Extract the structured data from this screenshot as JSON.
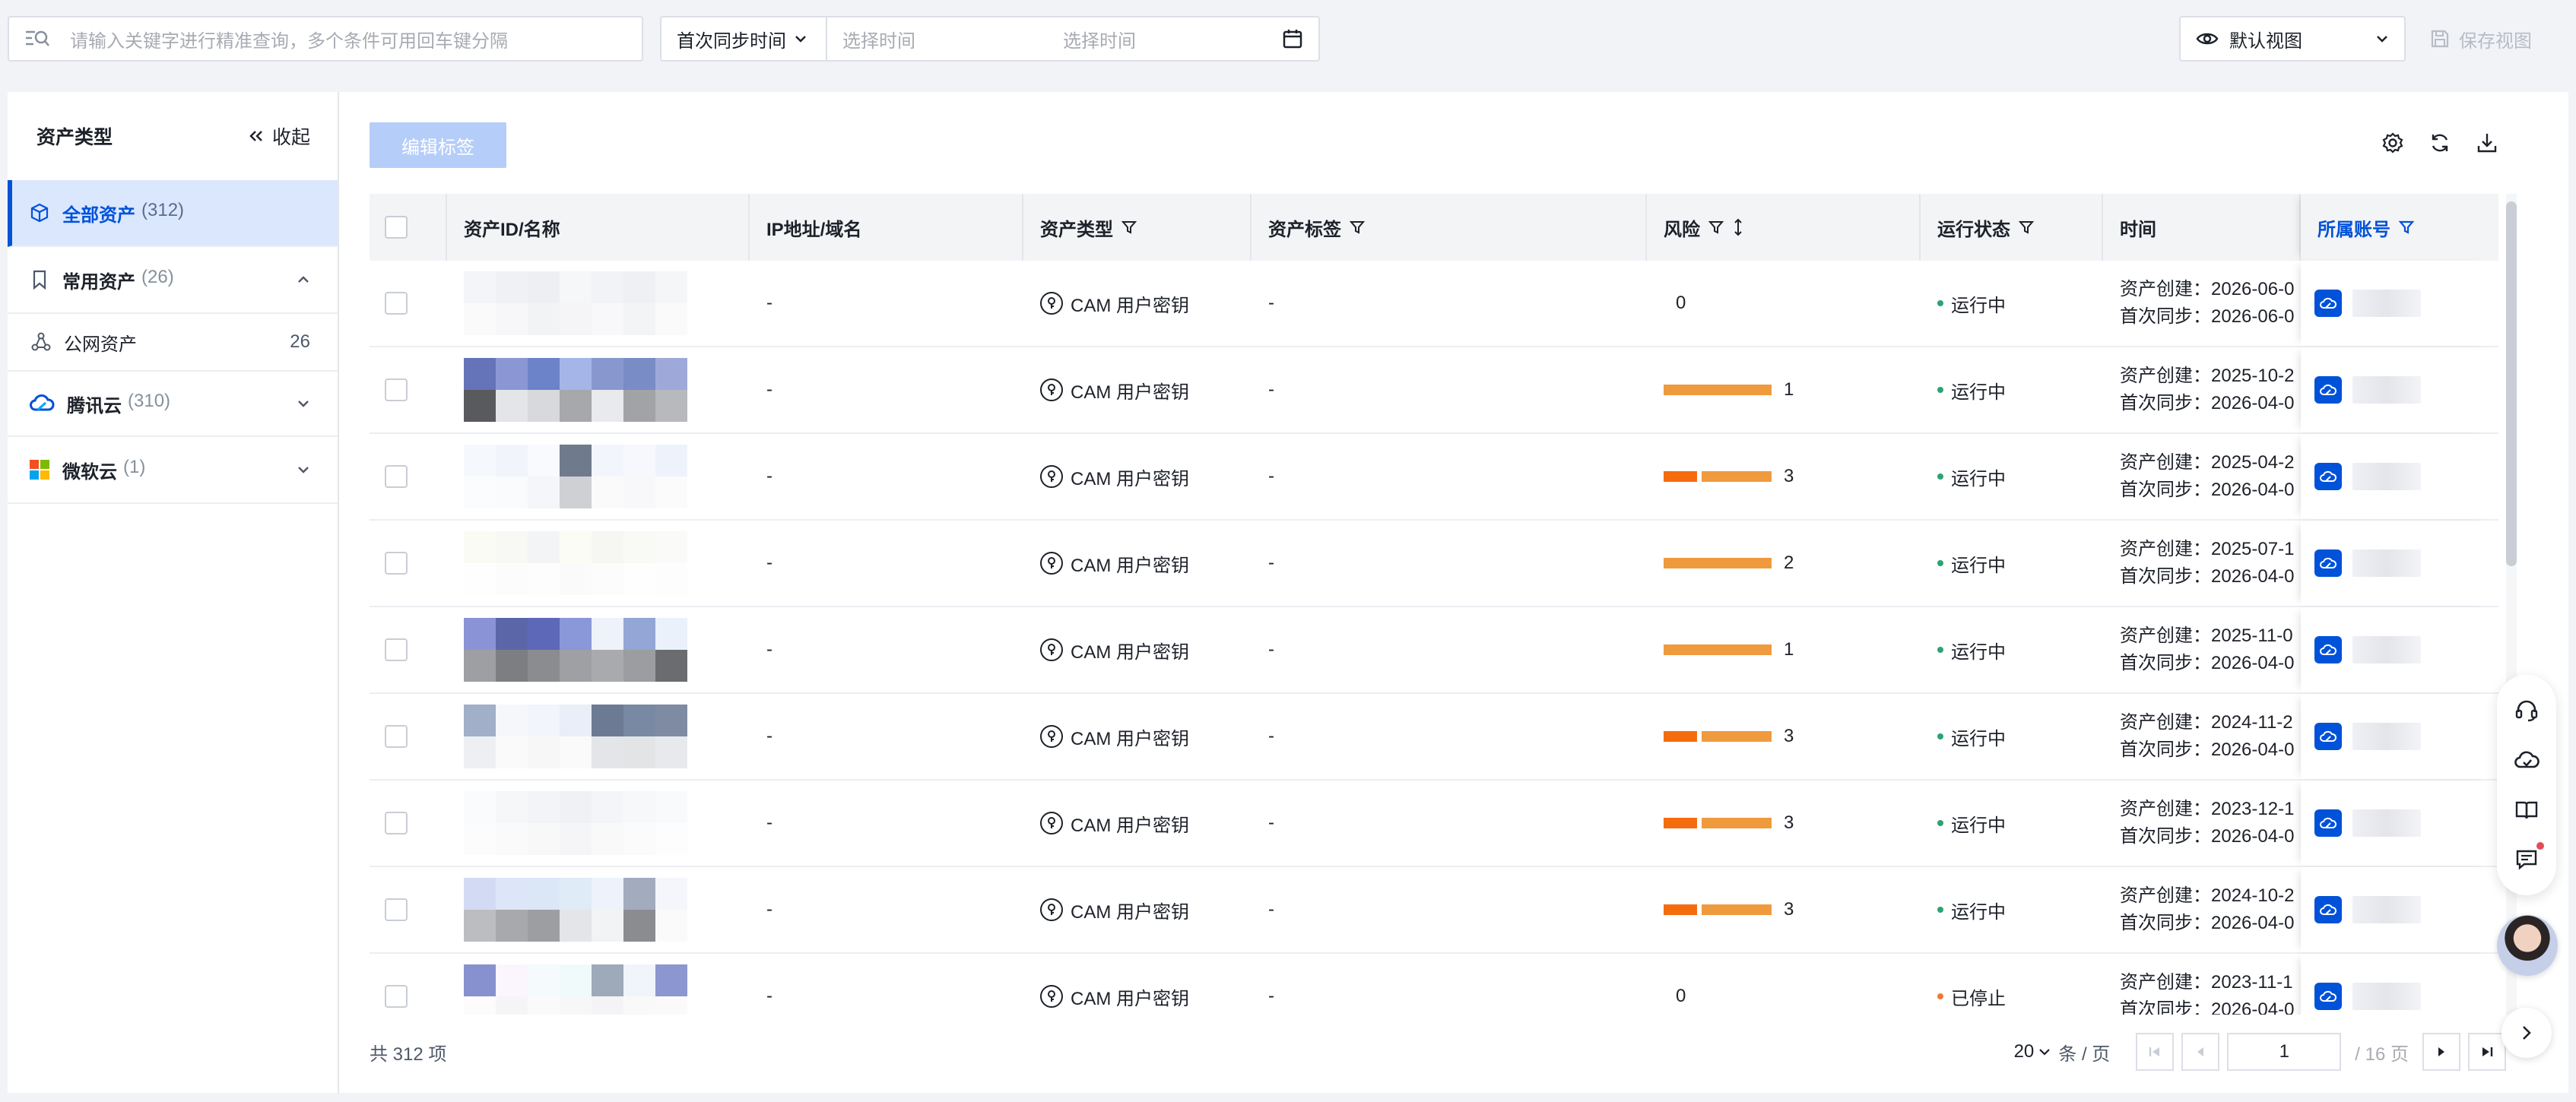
{
  "topbar": {
    "search_placeholder": "请输入关键字进行精准查询，多个条件可用回车键分隔",
    "time_filter_label": "首次同步时间",
    "date_start_placeholder": "选择时间",
    "date_end_placeholder": "选择时间",
    "view_label": "默认视图",
    "save_view_label": "保存视图"
  },
  "sidebar": {
    "title": "资产类型",
    "collapse_label": "收起",
    "items": [
      {
        "label": "全部资产",
        "count": "(312)"
      },
      {
        "label": "常用资产",
        "count": "(26)"
      },
      {
        "label": "公网资产",
        "count": "26"
      },
      {
        "label": "腾讯云",
        "count": "(310)"
      },
      {
        "label": "微软云",
        "count": "(1)"
      }
    ]
  },
  "toolbar": {
    "edit_tag_label": "编辑标签",
    "icons": [
      "settings-icon",
      "refresh-icon",
      "download-icon"
    ]
  },
  "table": {
    "columns": [
      "资产ID/名称",
      "IP地址/域名",
      "资产类型",
      "资产标签",
      "风险",
      "运行状态",
      "时间",
      "所属账号"
    ],
    "rows": [
      {
        "ip": "-",
        "type": "CAM 用户密钥",
        "tag": "-",
        "risk": "0",
        "risk_level": 0,
        "status": "运行中",
        "status_color": "#2ba471",
        "created": "资产创建：2026-06-0",
        "synced": "首次同步：2026-06-0"
      },
      {
        "ip": "-",
        "type": "CAM 用户密钥",
        "tag": "-",
        "risk": "1",
        "risk_level": 1,
        "status": "运行中",
        "status_color": "#2ba471",
        "created": "资产创建：2025-10-2",
        "synced": "首次同步：2026-04-0"
      },
      {
        "ip": "-",
        "type": "CAM 用户密钥",
        "tag": "-",
        "risk": "3",
        "risk_level": 3,
        "status": "运行中",
        "status_color": "#2ba471",
        "created": "资产创建：2025-04-2",
        "synced": "首次同步：2026-04-0"
      },
      {
        "ip": "-",
        "type": "CAM 用户密钥",
        "tag": "-",
        "risk": "2",
        "risk_level": 2,
        "status": "运行中",
        "status_color": "#2ba471",
        "created": "资产创建：2025-07-1",
        "synced": "首次同步：2026-04-0"
      },
      {
        "ip": "-",
        "type": "CAM 用户密钥",
        "tag": "-",
        "risk": "1",
        "risk_level": 1,
        "status": "运行中",
        "status_color": "#2ba471",
        "created": "资产创建：2025-11-0",
        "synced": "首次同步：2026-04-0"
      },
      {
        "ip": "-",
        "type": "CAM 用户密钥",
        "tag": "-",
        "risk": "3",
        "risk_level": 3,
        "status": "运行中",
        "status_color": "#2ba471",
        "created": "资产创建：2024-11-2",
        "synced": "首次同步：2026-04-0"
      },
      {
        "ip": "-",
        "type": "CAM 用户密钥",
        "tag": "-",
        "risk": "3",
        "risk_level": 3,
        "status": "运行中",
        "status_color": "#2ba471",
        "created": "资产创建：2023-12-1",
        "synced": "首次同步：2026-04-0"
      },
      {
        "ip": "-",
        "type": "CAM 用户密钥",
        "tag": "-",
        "risk": "3",
        "risk_level": 3,
        "status": "运行中",
        "status_color": "#2ba471",
        "created": "资产创建：2024-10-2",
        "synced": "首次同步：2026-04-0"
      },
      {
        "ip": "-",
        "type": "CAM 用户密钥",
        "tag": "-",
        "risk": "0",
        "risk_level": 0,
        "status": "已停止",
        "status_color": "#ed7b2f",
        "created": "资产创建：2023-11-1",
        "synced": "首次同步：2026-04-0"
      }
    ]
  },
  "footer": {
    "total_label": "共 312 项",
    "page_size": "20",
    "page_size_unit": "条 / 页",
    "current_page": "1",
    "total_pages": "/ 16 页"
  },
  "colors": {
    "accent": "#0052d9",
    "risk_high": "#f56c0e",
    "risk_mid": "#f09a3e",
    "running": "#2ba471",
    "stopped": "#ed7b2f"
  }
}
